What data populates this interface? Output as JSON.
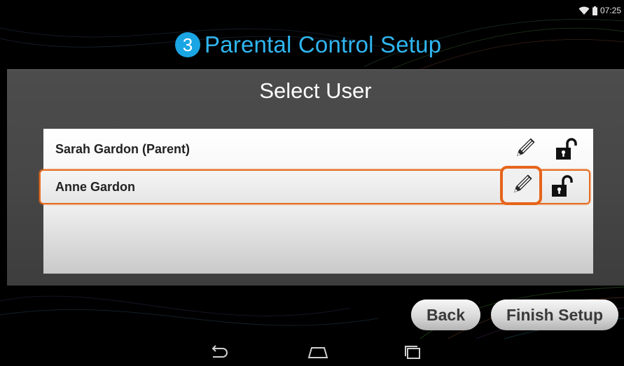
{
  "status_bar": {
    "time": "07:25",
    "icons": [
      "wifi-icon",
      "battery-icon"
    ]
  },
  "header": {
    "step_number": "3",
    "title": "Parental Control Setup"
  },
  "panel": {
    "heading": "Select User"
  },
  "users": [
    {
      "name": "Sarah Gardon (Parent)",
      "selected": false,
      "icons": [
        "pencil-icon",
        "unlocked-padlock-icon"
      ]
    },
    {
      "name": "Anne Gardon",
      "selected": true,
      "icons": [
        "pencil-icon",
        "unlocked-padlock-icon"
      ]
    }
  ],
  "buttons": {
    "back": "Back",
    "finish": "Finish Setup"
  },
  "nav_bar": {
    "icons": [
      "back-arrow-icon",
      "home-icon",
      "recent-apps-icon"
    ]
  },
  "colors": {
    "accent": "#2fb6f0",
    "badge": "#1aa6e4",
    "highlight": "#e5641a"
  }
}
